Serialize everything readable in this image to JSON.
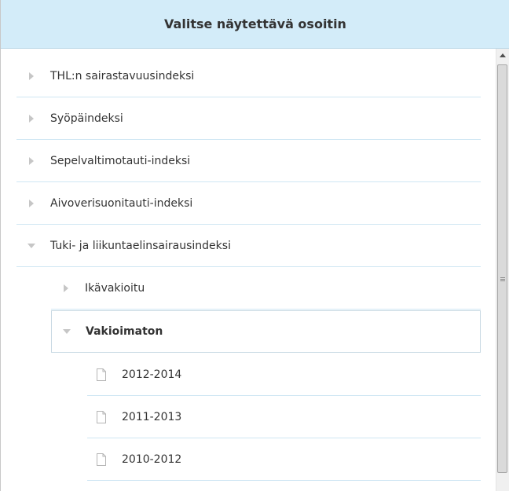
{
  "header": {
    "title": "Valitse näytettävä osoitin"
  },
  "tree": {
    "items": [
      {
        "label": "THL:n sairastavuusindeksi",
        "state": "collapsed"
      },
      {
        "label": "Syöpäindeksi",
        "state": "collapsed"
      },
      {
        "label": "Sepelvaltimotauti-indeksi",
        "state": "collapsed"
      },
      {
        "label": "Aivoverisuonitauti-indeksi",
        "state": "collapsed"
      },
      {
        "label": "Tuki- ja liikuntaelinsairausindeksi",
        "state": "expanded"
      }
    ],
    "sub": [
      {
        "label": "Ikävakioitu",
        "state": "collapsed"
      },
      {
        "label": "Vakioimaton",
        "state": "expanded",
        "selected": true
      }
    ],
    "leaves": [
      {
        "label": "2012-2014"
      },
      {
        "label": "2011-2013"
      },
      {
        "label": "2010-2012"
      }
    ]
  },
  "icons": {
    "collapsed": "triangle-right-icon",
    "expanded": "triangle-down-icon",
    "leaf": "document-icon"
  },
  "colors": {
    "header_bg": "#d3ecf9",
    "row_border": "#cfe6f3",
    "arrow": "#c6c6c6"
  }
}
